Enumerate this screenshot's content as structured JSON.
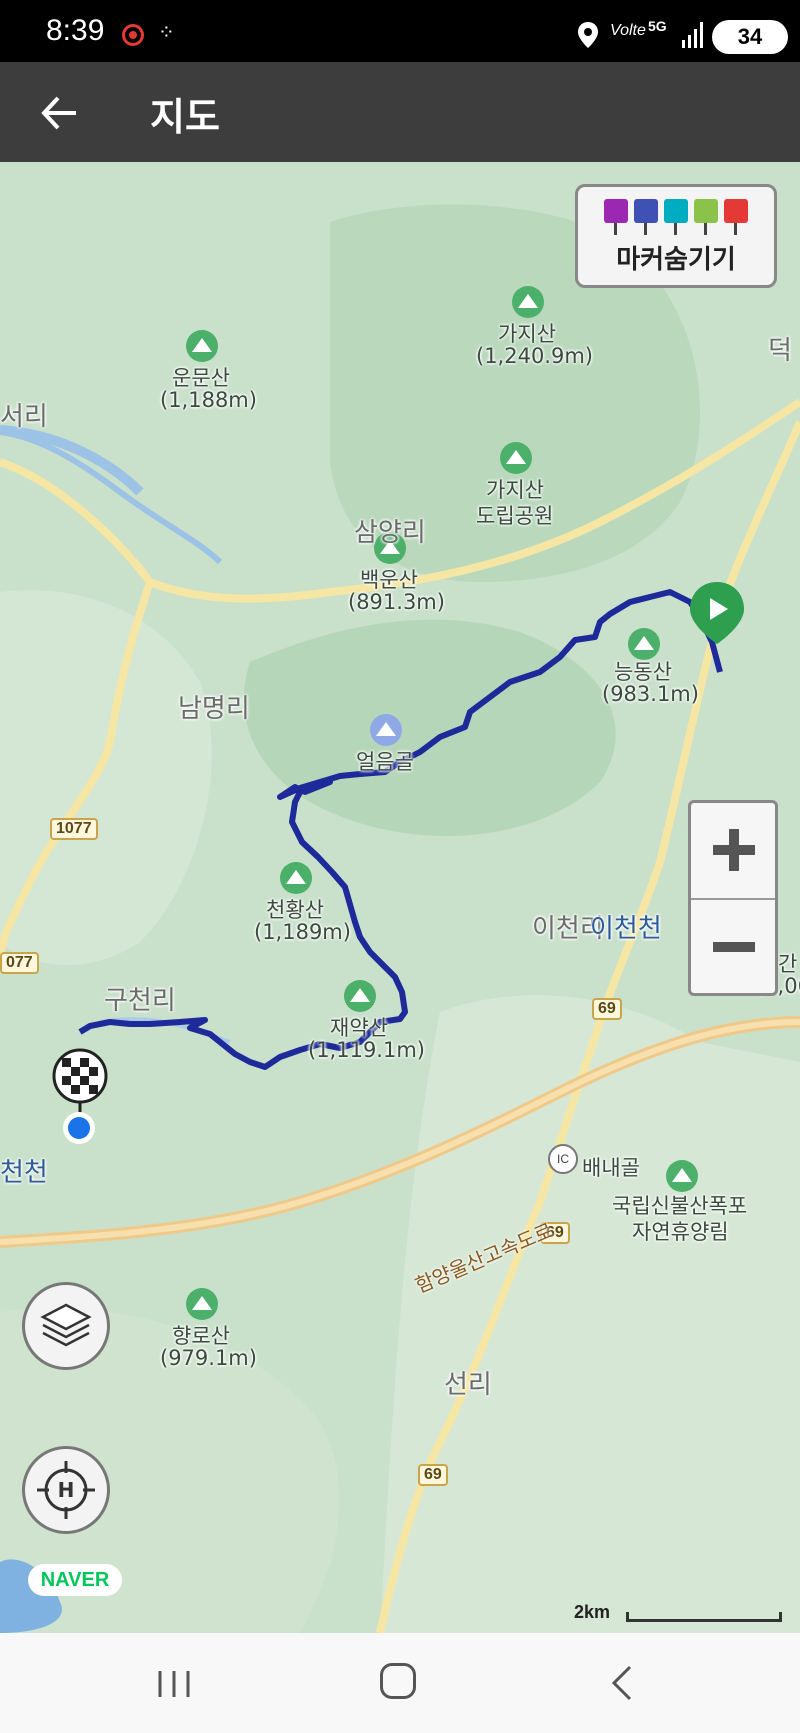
{
  "status_bar": {
    "time": "8:39",
    "recording_icon": "screen-record-icon",
    "app_icon": "grid-dots-icon",
    "volte": "Volte",
    "network": "5G",
    "battery": "34"
  },
  "app_bar": {
    "back_icon": "arrow-left-icon",
    "title": "지도"
  },
  "marker_panel": {
    "icons": [
      "camera-icon",
      "video-icon",
      "pin-icon",
      "memo-icon",
      "flag-icon"
    ],
    "colors": [
      "#9c27b0",
      "#3f51b5",
      "#00acc1",
      "#8bc34a",
      "#e53935"
    ],
    "label": "마커숨기기"
  },
  "map": {
    "mountains": [
      {
        "name": "가지산",
        "height": "(1,240.9m)"
      },
      {
        "name": "운문산",
        "height": "(1,188m)"
      },
      {
        "name": "가지산",
        "height": "도립공원"
      },
      {
        "name": "백운산",
        "height": "(891.3m)"
      },
      {
        "name": "능동산",
        "height": "(983.1m)"
      },
      {
        "name": "천황산",
        "height": "(1,189m)"
      },
      {
        "name": "재약산",
        "height": "(1,119.1m)"
      },
      {
        "name": "향로산",
        "height": "(979.1m)"
      },
      {
        "name": "국립신불산폭포",
        "height": "자연휴양림"
      },
      {
        "name": "간",
        "height": "(1,06"
      }
    ],
    "villages": [
      "서리",
      "삼양리",
      "남명리",
      "구천리",
      "선리",
      "덕",
      "이천리"
    ],
    "poi": {
      "name": "얼음골"
    },
    "rivers": [
      "이천천",
      "천천"
    ],
    "road_numbers": [
      "1077",
      "077",
      "69",
      "69",
      "69"
    ],
    "ic_badge": "IC",
    "ic_name": "배내골",
    "expressway": "함양울산고속도로",
    "scale": "2km",
    "logo": "NAVER"
  },
  "controls": {
    "zoom_in": "+",
    "zoom_out": "−",
    "layers_icon": "layers-icon",
    "location_icon": "target-h-icon"
  },
  "nav_bar": {
    "recents_icon": "recents-icon",
    "home_icon": "home-icon",
    "back_icon": "back-icon"
  }
}
